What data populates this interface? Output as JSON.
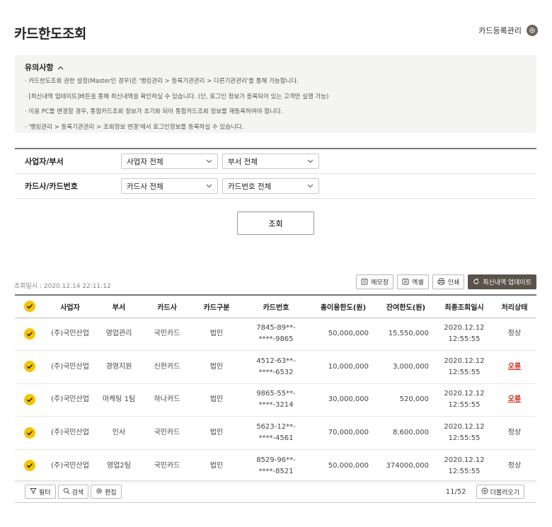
{
  "header": {
    "title": "카드한도조회",
    "card_mgmt_label": "카드등록관리"
  },
  "notice": {
    "title": "유의사항",
    "items": [
      "· 카드한도조회 권한 설정(Master인 경우)은 '뱅킹관리 > 등록기관관리 > 다른기관관리'를 통해 가능합니다.",
      "· [최신내역 업데이트]버튼을 통해 최신내역을 확인하실 수 있습니다. (단, 로그인 정보가 등록되어 있는 고객만 실행 가능)",
      "· 이용 PC를 변경할 경우, 통합카드조회 정보가 초기화 되어 통합카드조회 정보를 재등록하여야 합니다.",
      "· '뱅킹관리 > 등록기관관리 > 조회정보 변경'에서 로그인정보를 등록하실 수 있습니다."
    ]
  },
  "filters": {
    "row1": {
      "label": "사업자/부서",
      "select1": "사업자 전체",
      "select2": "부서 전체"
    },
    "row2": {
      "label": "카드사/카드번호",
      "select1": "카드사 전체",
      "select2": "카드번호 전체"
    }
  },
  "search_label": "조회",
  "lookup_time": "조회일시 : 2020.12.14 22:11:12",
  "toolbar": {
    "memo": "메모장",
    "excel": "엑셀",
    "print": "인쇄",
    "update": "최신내역 업데이트"
  },
  "table": {
    "headers": [
      "사업자",
      "부서",
      "카드사",
      "카드구분",
      "카드번호",
      "총이용한도(원)",
      "잔여한도(원)",
      "최종조회일시",
      "처리상태"
    ],
    "rows": [
      {
        "company": "(주)국민산업",
        "dept": "영업관리",
        "issuer": "국민카드",
        "type": "법인",
        "card1": "7845-89**-",
        "card2": "****-9865",
        "total": "50,000,000",
        "remain": "15,550,000",
        "date": "2020.12.12",
        "time": "12:55:55",
        "status": "정상",
        "error": false
      },
      {
        "company": "(주)국민산업",
        "dept": "경영지원",
        "issuer": "신한카드",
        "type": "법인",
        "card1": "4512-63**-",
        "card2": "****-6532",
        "total": "10,000,000",
        "remain": "3,000,000",
        "date": "2020.12.12",
        "time": "12:55:55",
        "status": "오류",
        "error": true
      },
      {
        "company": "(주)국민산업",
        "dept": "마케팅 1팀",
        "issuer": "하나카드",
        "type": "법인",
        "card1": "9865-55**-",
        "card2": "****-3214",
        "total": "30,000,000",
        "remain": "520,000",
        "date": "2020.12.12",
        "time": "12:55:55",
        "status": "오류",
        "error": true
      },
      {
        "company": "(주)국민산업",
        "dept": "인사",
        "issuer": "국민카드",
        "type": "법인",
        "card1": "5623-12**-",
        "card2": "****-4561",
        "total": "70,000,000",
        "remain": "8,600,000",
        "date": "2020.12.12",
        "time": "12:55:55",
        "status": "정상",
        "error": false
      },
      {
        "company": "(주)국민산업",
        "dept": "영업2팀",
        "issuer": "국민카드",
        "type": "법인",
        "card1": "8529-96**-",
        "card2": "****-8521",
        "total": "50,000,000",
        "remain": "374000,000",
        "date": "2020.12.12",
        "time": "12:55:55",
        "status": "정상",
        "error": false
      }
    ]
  },
  "footer": {
    "filter": "필터",
    "search": "검색",
    "edit": "편집",
    "page_count": "11/52",
    "load_more": "더불러오기"
  },
  "colors": {
    "accent_yellow": "#f5c400",
    "dark_brown": "#5b5249",
    "error_red": "#d0271b"
  }
}
